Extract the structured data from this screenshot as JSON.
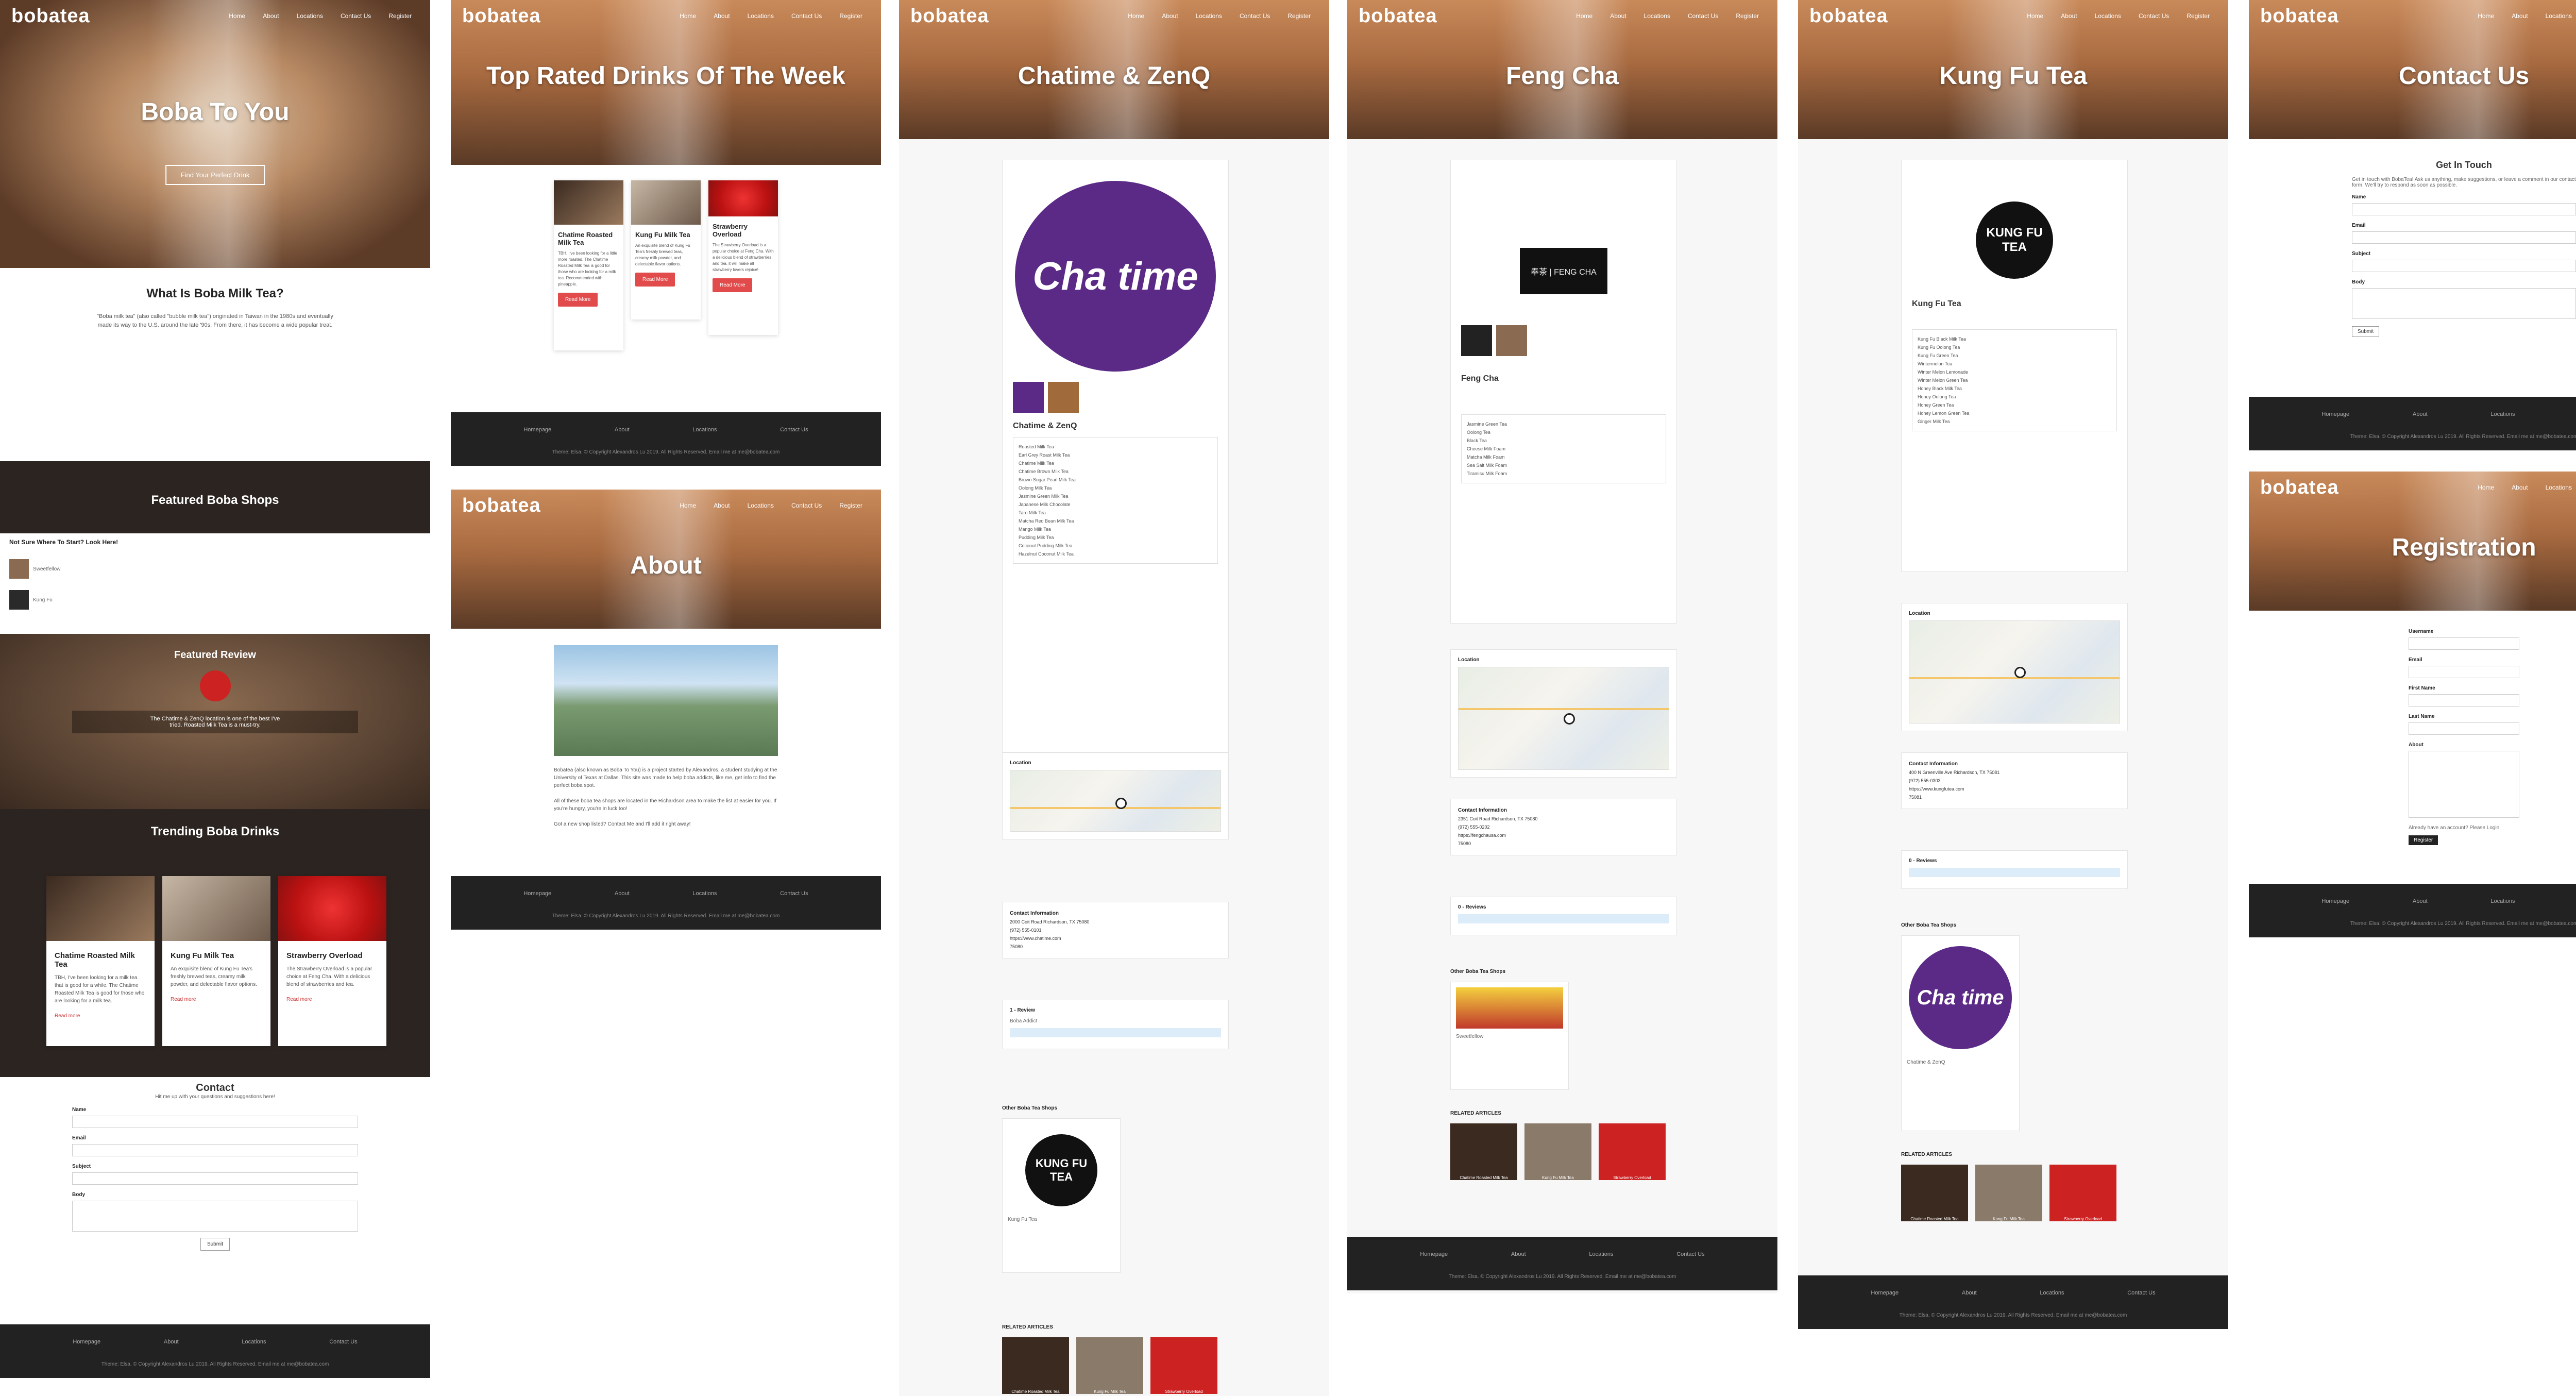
{
  "site": {
    "logo": "bobatea",
    "nav": [
      "Home",
      "About",
      "Locations",
      "Contact Us",
      "Register"
    ]
  },
  "home": {
    "hero_title": "Boba To You",
    "hero_button": "Find Your Perfect Drink",
    "what_is_title": "What Is Boba Milk Tea?",
    "what_is_body": "\"Boba milk tea\" (also called \"bubble milk tea\") originated in Taiwan in the 1980s and eventually made its way to the U.S. around the late '90s. From there, it has become a wide popular treat.",
    "featured_shops_title": "Featured Boba Shops",
    "not_sure": "Not Sure Where To Start? Look Here!",
    "shops": [
      {
        "name": "Sweetfellow"
      },
      {
        "name": "Kung Fu"
      }
    ],
    "featured_review_title": "Featured Review",
    "featured_review_quote": "The Chatime & ZenQ location is one of the best I've tried. Roasted Milk Tea is a must-try.",
    "trending_title": "Trending Boba Drinks",
    "trending": [
      {
        "name": "Chatime Roasted Milk Tea",
        "desc": "TBH, I've been looking for a milk tea that is good for a while. The Chatime Roasted Milk Tea is good for those who are looking for a milk tea.",
        "more": "Read more"
      },
      {
        "name": "Kung Fu Milk Tea",
        "desc": "An exquisite blend of Kung Fu Tea's freshly brewed teas, creamy milk powder, and delectable flavor options.",
        "more": "Read more"
      },
      {
        "name": "Strawberry Overload",
        "desc": "The Strawberry Overload is a popular choice at Feng Cha. With a delicious blend of strawberries and tea.",
        "more": "Read more"
      }
    ],
    "contact_title": "Contact",
    "contact_sub": "Hit me up with your questions and suggestions here!",
    "contact_fields": [
      "Name",
      "Email",
      "Subject",
      "Body"
    ],
    "submit": "Submit"
  },
  "top_rated": {
    "hero_title": "Top Rated Drinks Of The Week",
    "drinks": [
      {
        "name": "Chatime Roasted Milk Tea",
        "desc": "TBH, I've been looking for a little more roasted. The Chatime Roasted Milk Tea is good for those who are looking for a milk tea. Recommended with pineapple.",
        "button": "Read More"
      },
      {
        "name": "Kung Fu Milk Tea",
        "desc": "An exquisite blend of Kung Fu Tea's freshly brewed teas, creamy milk powder, and delectable flavor options.",
        "button": "Read More"
      },
      {
        "name": "Strawberry Overload",
        "desc": "The Strawberry Overload is a popular choice at Feng Cha. With a delicious blend of strawberries and tea, it will make all strawberry lovers rejoice!",
        "button": "Read More"
      }
    ]
  },
  "about": {
    "hero_title": "About",
    "body1": "Bobatea (also known as Boba To You) is a project started by Alexandros, a student studying at the University of Texas at Dallas. This site was made to help boba addicts, like me, get info to find the perfect boba spot.",
    "body2": "All of these boba tea shops are located in the Richardson area to make the list at easier for you. If you're hungry, you're in luck too!",
    "body3": "Got a new shop listed? Contact Me and I'll add it right away!"
  },
  "chatime": {
    "hero_title": "Chatime & ZenQ",
    "shop_name": "Chatime & ZenQ",
    "logo_text": "Cha time",
    "location_label": "Location",
    "contact_label": "Contact Information",
    "address": "2000 Coit Road Richardson, TX 75080",
    "phone": "(972) 555-0101",
    "website": "https://www.chatime.com",
    "zip": "75080",
    "reviews_label": "1 - Review",
    "reviewer": "Boba Addict",
    "other_shops": "Other Boba Tea Shops",
    "other_shop_name": "Kung Fu Tea",
    "related": "RELATED ARTICLES",
    "related_items": [
      "Chatime Roasted Milk Tea",
      "Kung Fu Milk Tea",
      "Strawberry Overload"
    ],
    "menu": [
      "Roasted Milk Tea",
      "Earl Grey Roast Milk Tea",
      "Chatime Milk Tea",
      "Chatime Brown Milk Tea",
      "Brown Sugar Pearl Milk Tea",
      "Oolong Milk Tea",
      "Jasmine Green Milk Tea",
      "Japanese Milk Chocolate",
      "Taro Milk Tea",
      "Matcha Red Bean Milk Tea",
      "Mango Milk Tea",
      "Pudding Milk Tea",
      "Coconut Pudding Milk Tea",
      "Hazelnut Coconut Milk Tea"
    ]
  },
  "fengcha": {
    "hero_title": "Feng Cha",
    "shop_name": "Feng Cha",
    "logo_text": "奉茶 | FENG CHA",
    "address": "2351 Coit Road Richardson, TX 75080",
    "phone": "(972) 555-0202",
    "website": "https://fengchausa.com",
    "zip": "75080",
    "location_label": "Location",
    "contact_label": "Contact Information",
    "reviews_label": "0 - Reviews",
    "other_shops": "Other Boba Tea Shops",
    "other_shop_name": "Sweetfellow",
    "related": "RELATED ARTICLES",
    "related_items": [
      "Chatime Roasted Milk Tea",
      "Kung Fu Milk Tea",
      "Strawberry Overload"
    ],
    "menu": [
      "Jasmine Green Tea",
      "Oolong Tea",
      "Black Tea",
      "Cheese Milk Foam",
      "Matcha Milk Foam",
      "Sea Salt Milk Foam",
      "Tiramisu Milk Foam"
    ]
  },
  "kungfu": {
    "hero_title": "Kung Fu Tea",
    "shop_name": "Kung Fu Tea",
    "logo_text": "KUNG FU TEA",
    "address": "400 N Greenville Ave Richardson, TX 75081",
    "phone": "(972) 555-0303",
    "website": "https://www.kungfutea.com",
    "zip": "75081",
    "location_label": "Location",
    "contact_label": "Contact Information",
    "reviews_label": "0 - Reviews",
    "other_shops": "Other Boba Tea Shops",
    "other_shop_name": "Chatime & ZenQ",
    "related": "RELATED ARTICLES",
    "related_items": [
      "Chatime Roasted Milk Tea",
      "Kung Fu Milk Tea",
      "Strawberry Overload"
    ],
    "menu": [
      "Kung Fu Black Milk Tea",
      "Kung Fu Oolong Tea",
      "Kung Fu Green Tea",
      "Wintermelon Tea",
      "Winter Melon Lemonade",
      "Winter Melon Green Tea",
      "Honey Black Milk Tea",
      "Honey Oolong Tea",
      "Honey Green Tea",
      "Honey Lemon Green Tea",
      "Ginger Milk Tea"
    ]
  },
  "contact": {
    "hero_title": "Contact Us",
    "heading": "Get In Touch",
    "intro": "Get in touch with BobaTea! Ask us anything, make suggestions, or leave a comment in our contact form. We'll try to respond as soon as possible.",
    "fields": [
      "Name",
      "Email",
      "Subject",
      "Body"
    ],
    "submit": "Submit"
  },
  "register": {
    "hero_title": "Registration",
    "fields": [
      "Username",
      "Email",
      "First Name",
      "Last Name",
      "About"
    ],
    "submit": "Register",
    "login": "Already have an account? Please Login"
  },
  "footer": {
    "links": [
      "Homepage",
      "About",
      "Locations",
      "Contact Us"
    ],
    "copy": "Theme: Elsa. © Copyright Alexandros Lu 2019. All Rights Reserved. Email me at me@bobatea.com"
  },
  "colors": {
    "accent": "#e24b4b",
    "dark": "#2b2421",
    "footer": "#222222"
  }
}
